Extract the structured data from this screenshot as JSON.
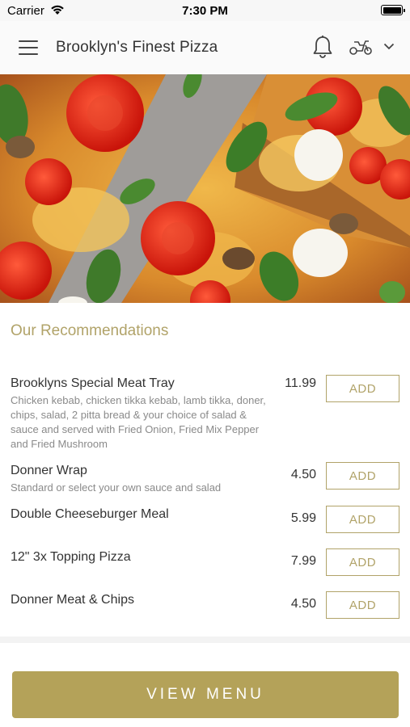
{
  "status_bar": {
    "carrier": "Carrier",
    "time": "7:30 PM"
  },
  "header": {
    "title": "Brooklyn's Finest Pizza",
    "icons": [
      "menu-icon",
      "bell-icon",
      "scooter-icon",
      "chevron-down-icon"
    ]
  },
  "recommendations": {
    "title": "Our Recommendations",
    "add_label": "ADD",
    "items": [
      {
        "name": "Brooklyns Special Meat Tray",
        "description": "Chicken kebab, chicken tikka kebab, lamb tikka, doner, chips, salad, 2 pitta bread & your choice of salad & sauce and served with Fried Onion, Fried Mix Pepper and Fried Mushroom",
        "price": "11.99"
      },
      {
        "name": "Donner Wrap",
        "description": "Standard or select your own sauce and salad",
        "price": "4.50"
      },
      {
        "name": "Double Cheeseburger Meal",
        "description": "",
        "price": "5.99"
      },
      {
        "name": "12\" 3x Topping Pizza",
        "description": "",
        "price": "7.99"
      },
      {
        "name": "Donner Meat & Chips",
        "description": "",
        "price": "4.50"
      }
    ]
  },
  "footer": {
    "view_menu_label": "VIEW MENU"
  },
  "colors": {
    "accent": "#b1a369",
    "button": "#b4a259",
    "text": "#333333",
    "muted": "#8a8a8a"
  }
}
